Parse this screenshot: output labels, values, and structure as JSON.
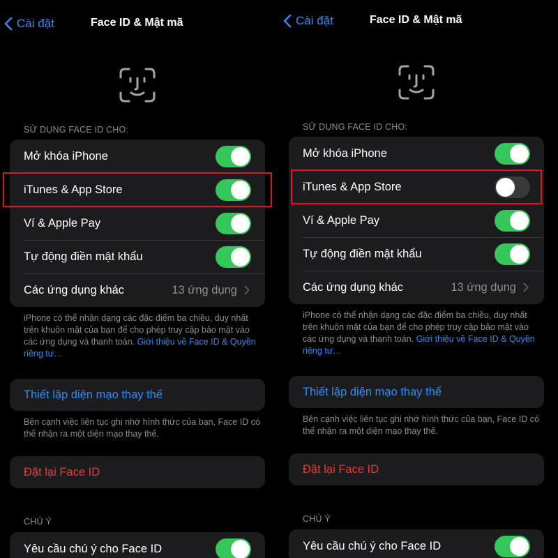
{
  "colors": {
    "accent": "#2f8cf4",
    "toggle_on": "#34c759",
    "toggle_off": "#39393d",
    "destructive": "#eb3b30",
    "highlight_box": "#e3131b"
  },
  "panels": [
    {
      "back_label": "Cài đặt",
      "title": "Face ID & Mật mã",
      "section_header": "SỬ DỤNG FACE ID CHO:",
      "rows": [
        {
          "label": "Mở khóa iPhone",
          "toggle_on": true
        },
        {
          "label": "iTunes & App Store",
          "toggle_on": true
        },
        {
          "label": "Ví & Apple Pay",
          "toggle_on": true
        },
        {
          "label": "Tự động điền mật khẩu",
          "toggle_on": true
        },
        {
          "label": "Các ứng dụng khác",
          "detail": "13 ứng dụng"
        }
      ],
      "footer_text": "iPhone có thể nhận dạng các đặc điểm ba chiều, duy nhất trên khuôn mặt của bạn để cho phép truy cập bảo mật vào các ứng dụng và thanh toán. ",
      "footer_link": "Giới thiệu về Face ID & Quyền riêng tư…",
      "alt_appearance_label": "Thiết lập diện mạo thay thế",
      "alt_appearance_footer": "Bên cạnh việc liên tục ghi nhớ hình thức của bạn, Face ID có thể nhận ra một diện mạo thay thế.",
      "reset_label": "Đặt lại Face ID",
      "attention_header": "CHÚ Ý",
      "attention_row": {
        "label": "Yêu cầu chú ý cho Face ID",
        "toggle_on": true
      }
    },
    {
      "back_label": "Cài đặt",
      "title": "Face ID & Mật mã",
      "section_header": "SỬ DỤNG FACE ID CHO:",
      "rows": [
        {
          "label": "Mở khóa iPhone",
          "toggle_on": true
        },
        {
          "label": "iTunes & App Store",
          "toggle_on": false
        },
        {
          "label": "Ví & Apple Pay",
          "toggle_on": true
        },
        {
          "label": "Tự động điền mật khẩu",
          "toggle_on": true
        },
        {
          "label": "Các ứng dụng khác",
          "detail": "13 ứng dụng"
        }
      ],
      "footer_text": "iPhone có thể nhận dạng các đặc điểm ba chiều, duy nhất trên khuôn mặt của bạn để cho phép truy cập bảo mật vào các ứng dụng và thanh toán. ",
      "footer_link": "Giới thiệu về Face ID & Quyền riêng tư…",
      "alt_appearance_label": "Thiết lập diện mạo thay thế",
      "alt_appearance_footer": "Bên cạnh việc liên tục ghi nhớ hình thức của bạn, Face ID có thể nhận ra một diện mạo thay thế.",
      "reset_label": "Đặt lại Face ID",
      "attention_header": "CHÚ Ý",
      "attention_row": {
        "label": "Yêu cầu chú ý cho Face ID",
        "toggle_on": true
      }
    }
  ]
}
